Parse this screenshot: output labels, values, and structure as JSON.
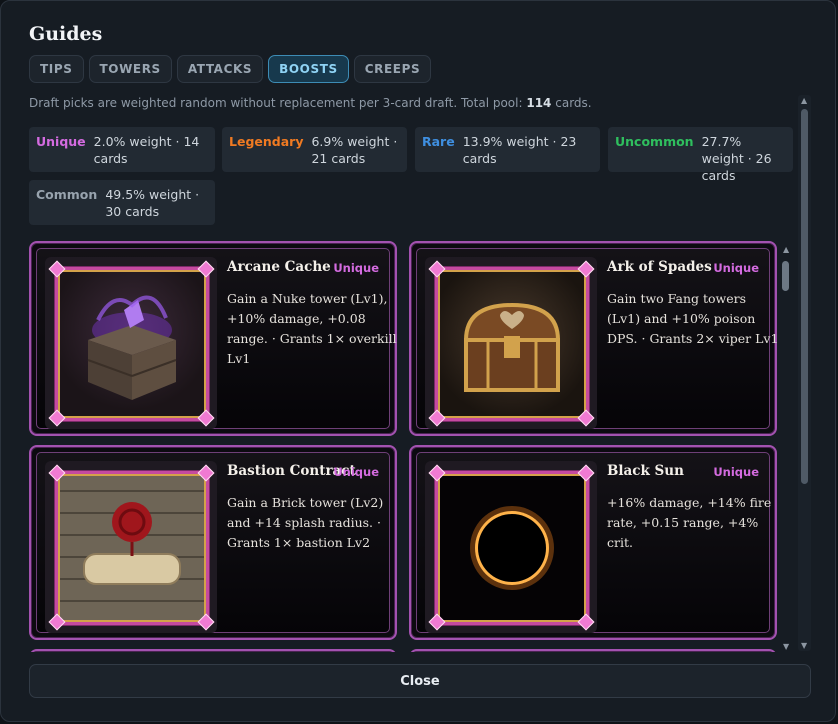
{
  "title": "Guides",
  "tabs": [
    {
      "label": "TIPS"
    },
    {
      "label": "TOWERS"
    },
    {
      "label": "ATTACKS"
    },
    {
      "label": "BOOSTS"
    },
    {
      "label": "CREEPS"
    }
  ],
  "active_tab": "BOOSTS",
  "description": {
    "prefix": "Draft picks are weighted random without replacement per 3-card draft. Total pool:",
    "total": "114",
    "suffix": "cards."
  },
  "rarities": [
    {
      "name": "Unique",
      "info": "2.0% weight · 14 cards",
      "color": "#d46be0"
    },
    {
      "name": "Legendary",
      "info": "6.9% weight · 21 cards",
      "color": "#f07a22"
    },
    {
      "name": "Rare",
      "info": "13.9% weight · 23 cards",
      "color": "#3f8fe0"
    },
    {
      "name": "Uncommon",
      "info": "27.7% weight · 26 cards",
      "color": "#2fbf5e"
    },
    {
      "name": "Common",
      "info": "49.5% weight · 30 cards",
      "color": "#98a3ae"
    }
  ],
  "cards": [
    {
      "name": "Arcane Cache",
      "rarity": "Unique",
      "description": "Gain a Nuke tower (Lv1), +10% damage, +0.08 range. · Grants 1× overkill Lv1",
      "art_icon": "arcane-crate-icon"
    },
    {
      "name": "Ark of Spades",
      "rarity": "Unique",
      "description": "Gain two Fang towers (Lv1) and +10% poison DPS. · Grants 2× viper Lv1",
      "art_icon": "treasure-chest-icon"
    },
    {
      "name": "Bastion Contract",
      "rarity": "Unique",
      "description": "Gain a Brick tower (Lv2) and +14 splash radius. · Grants 1× bastion Lv2",
      "art_icon": "sealed-scroll-icon"
    },
    {
      "name": "Black Sun",
      "rarity": "Unique",
      "description": "+16% damage, +14% fire rate, +0.15 range, +4% crit.",
      "art_icon": "eclipse-icon"
    }
  ],
  "close_label": "Close"
}
